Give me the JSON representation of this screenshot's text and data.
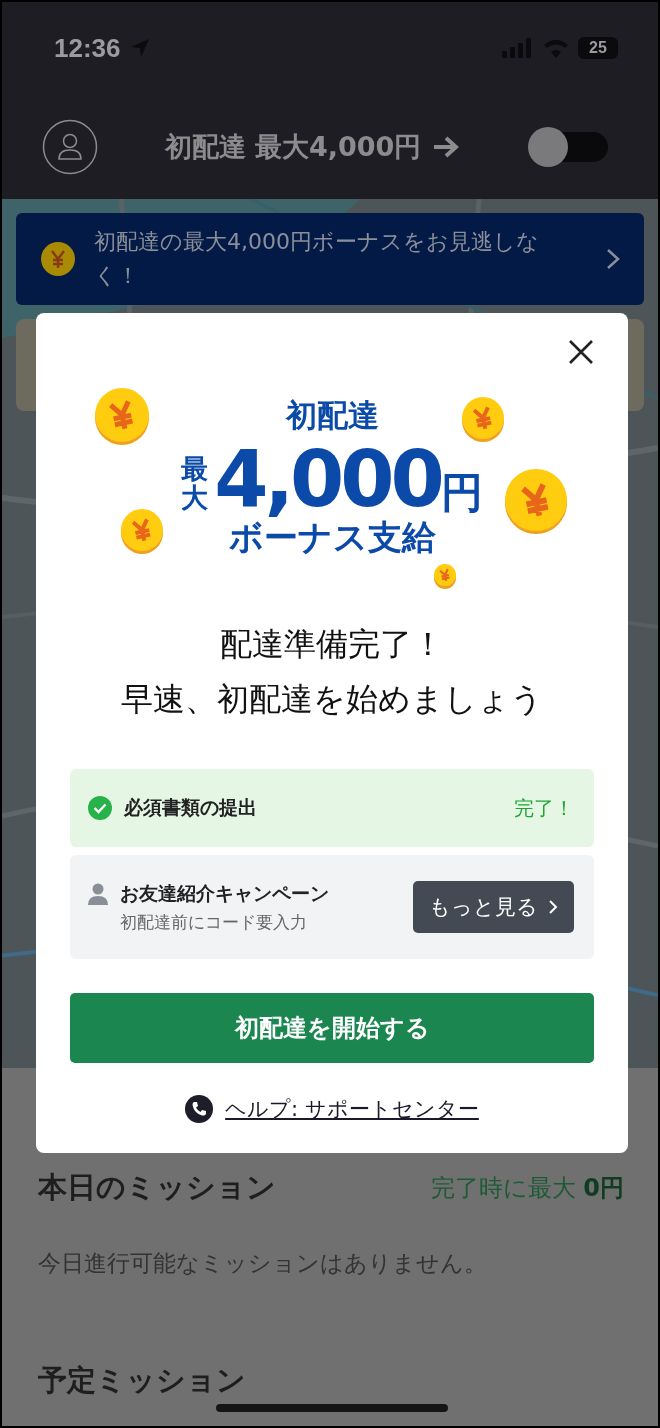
{
  "status_bar": {
    "time": "12:36",
    "battery": "25"
  },
  "header": {
    "title": "初配達 最大4,000円",
    "toggle": {
      "on": false
    }
  },
  "promo_banner": {
    "text": "初配達の最大4,000円ボーナスをお見逃しなく！"
  },
  "modal": {
    "bonus": {
      "line_1": "初配達",
      "prefix": "最大",
      "amount": "4,000",
      "unit": "円",
      "line_3": "ボーナス支給"
    },
    "headline": [
      "配達準備完了！",
      "早速、初配達を始めましょう"
    ],
    "tasks": [
      {
        "kind": "done",
        "title": "必須書類の提出",
        "status": "完了！"
      },
      {
        "kind": "referral",
        "title": "お友達紹介キャンペーン",
        "subtitle": "初配達前にコード要入力",
        "button": "もっと見る"
      }
    ],
    "primary_button": "初配達を開始する",
    "help_link": "ヘルプ: サポートセンター"
  },
  "missions": {
    "today_title": "本日のミッション",
    "reward": "完了時に最大 **0円**",
    "empty": "今日進行可能なミッションはありません。",
    "upcoming_title": "予定ミッション"
  }
}
